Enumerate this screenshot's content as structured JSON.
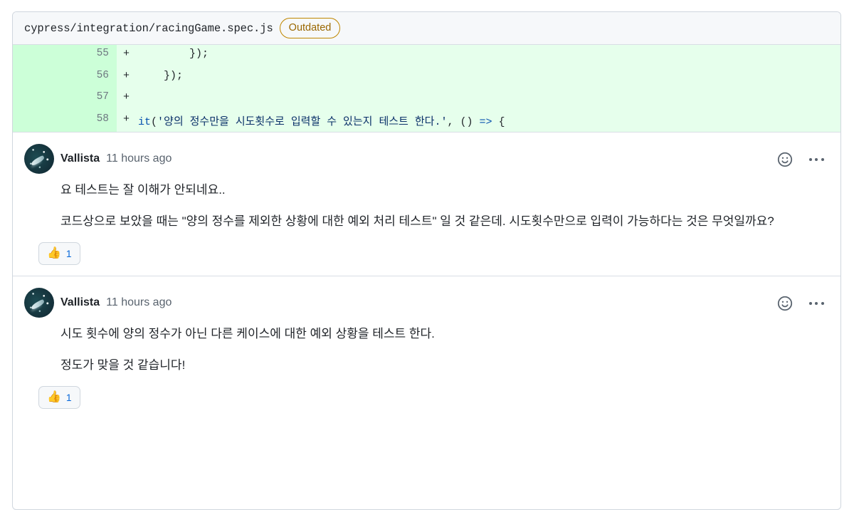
{
  "file": {
    "path": "cypress/integration/racingGame.spec.js",
    "badge": "Outdated"
  },
  "diff": {
    "lines": [
      {
        "number": "55",
        "marker": "+",
        "code": "        });"
      },
      {
        "number": "56",
        "marker": "+",
        "code": "    });"
      },
      {
        "number": "57",
        "marker": "+",
        "code": ""
      },
      {
        "number": "58",
        "marker": "+",
        "code": "it('양의 정수만을 시도횟수로 입력할 수 있는지 테스트 한다.', () => {",
        "tokens": {
          "fn": "it",
          "open": "(",
          "string": "'양의 정수만을 시도횟수로 입력할 수 있는지 테스트 한다.'",
          "after": ", () ",
          "arrow": "=>",
          "brace": " {"
        }
      }
    ]
  },
  "comments": [
    {
      "author": "Vallista",
      "timestamp": "11 hours ago",
      "avatar_alt": "space-avatar",
      "paragraphs": [
        "요 테스트는 잘 이해가 안되네요..",
        "코드상으로 보았을 때는 \"양의 정수를 제외한 상황에 대한 예외 처리 테스트\" 일 것 같은데. 시도횟수만으로 입력이 가능하다는 것은 무엇일까요?"
      ],
      "reaction": {
        "emoji": "👍",
        "count": "1"
      }
    },
    {
      "author": "Vallista",
      "timestamp": "11 hours ago",
      "avatar_alt": "space-avatar",
      "paragraphs": [
        "시도 횟수에 양의 정수가 아닌 다른 케이스에 대한 예외 상황을 테스트 한다.",
        "정도가 맞을 것 같습니다!"
      ],
      "reaction": {
        "emoji": "👍",
        "count": "1"
      }
    }
  ],
  "icons": {
    "add_reaction": "smiley-icon",
    "more_options": "kebab-icon"
  },
  "colors": {
    "diff_add_bg": "#e6ffec",
    "diff_add_gutter": "#ccffd8",
    "badge_outdated": "#9a6700",
    "link_blue": "#0969da",
    "border": "#d0d7de"
  }
}
